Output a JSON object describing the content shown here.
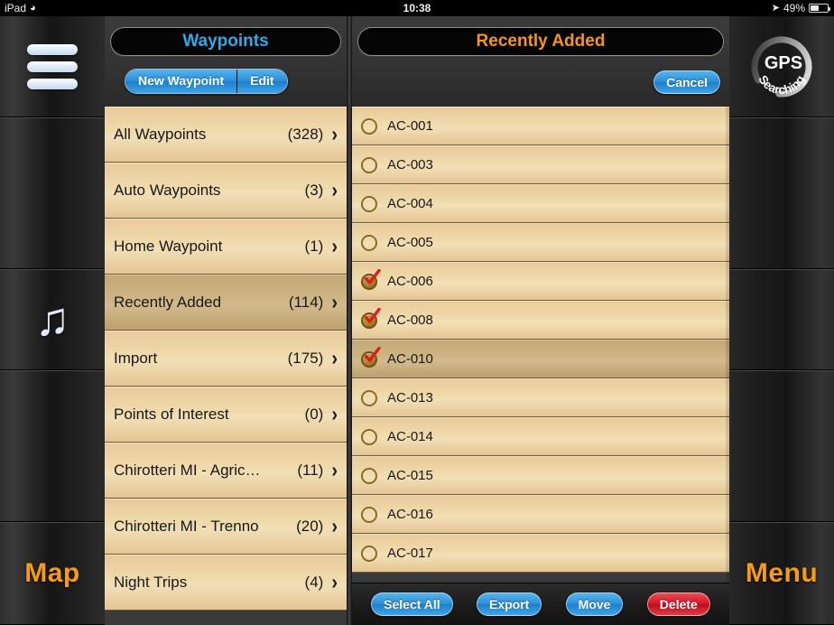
{
  "statusbar": {
    "device": "iPad",
    "wifi_icon": "wifi-icon",
    "time": "10:38",
    "location_icon": "location-arrow-icon",
    "battery_percent": "49%",
    "battery_icon": "battery-icon"
  },
  "rail_left": {
    "menu_icon": "hamburger-menu-icon",
    "music_icon": "music-note-icon",
    "map_label": "Map"
  },
  "rail_right": {
    "gps_line1": "GPS",
    "gps_line2": "Searching",
    "menu_label": "Menu"
  },
  "left_panel": {
    "title": "Waypoints",
    "title_color": "#2fa9e8",
    "new_waypoint_label": "New Waypoint",
    "edit_label": "Edit",
    "chevron_icon": "chevron-right-icon",
    "rows": [
      {
        "label": "All Waypoints",
        "count": "(328)",
        "selected": false
      },
      {
        "label": "Auto Waypoints",
        "count": "(3)",
        "selected": false
      },
      {
        "label": "Home Waypoint",
        "count": "(1)",
        "selected": false
      },
      {
        "label": "Recently Added",
        "count": "(114)",
        "selected": true
      },
      {
        "label": "Import",
        "count": "(175)",
        "selected": false
      },
      {
        "label": "Points of Interest",
        "count": "(0)",
        "selected": false
      },
      {
        "label": "Chirotteri MI - Agric…",
        "count": "(11)",
        "selected": false
      },
      {
        "label": "Chirotteri MI - Trenno",
        "count": "(20)",
        "selected": false
      },
      {
        "label": "Night Trips",
        "count": "(4)",
        "selected": false
      }
    ]
  },
  "right_panel": {
    "title": "Recently Added",
    "title_color": "#f5951e",
    "cancel_label": "Cancel",
    "checkbox_icon_unchecked": "circle-unchecked-icon",
    "checkbox_icon_checked": "circle-checked-icon",
    "rows": [
      {
        "label": "AC-001",
        "checked": false,
        "selected": false
      },
      {
        "label": "AC-003",
        "checked": false,
        "selected": false
      },
      {
        "label": "AC-004",
        "checked": false,
        "selected": false
      },
      {
        "label": "AC-005",
        "checked": false,
        "selected": false
      },
      {
        "label": "AC-006",
        "checked": true,
        "selected": false
      },
      {
        "label": "AC-008",
        "checked": true,
        "selected": false
      },
      {
        "label": "AC-010",
        "checked": true,
        "selected": true
      },
      {
        "label": "AC-013",
        "checked": false,
        "selected": false
      },
      {
        "label": "AC-014",
        "checked": false,
        "selected": false
      },
      {
        "label": "AC-015",
        "checked": false,
        "selected": false
      },
      {
        "label": "AC-016",
        "checked": false,
        "selected": false
      },
      {
        "label": "AC-017",
        "checked": false,
        "selected": false
      }
    ],
    "toolbar": [
      {
        "label": "Select All",
        "style": "primary"
      },
      {
        "label": "Export",
        "style": "primary"
      },
      {
        "label": "Move",
        "style": "primary"
      },
      {
        "label": "Delete",
        "style": "danger"
      }
    ]
  }
}
